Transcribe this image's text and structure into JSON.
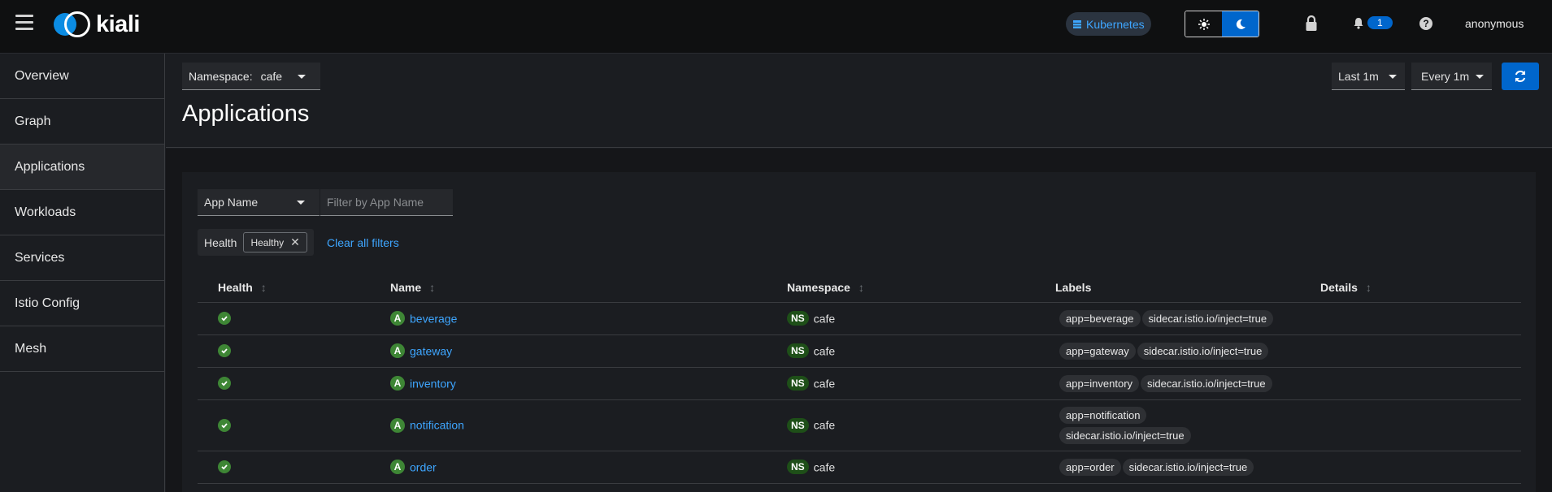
{
  "masthead": {
    "logo_text": "kiali",
    "cluster": "Kubernetes",
    "notifications_count": "1",
    "help_symbol": "?",
    "user": "anonymous",
    "accent": "#0066cc"
  },
  "sidebar": {
    "items": [
      {
        "label": "Overview"
      },
      {
        "label": "Graph"
      },
      {
        "label": "Applications"
      },
      {
        "label": "Workloads"
      },
      {
        "label": "Services"
      },
      {
        "label": "Istio Config"
      },
      {
        "label": "Mesh"
      }
    ],
    "active": "Applications"
  },
  "toolbar": {
    "namespace_label": "Namespace:",
    "namespace_value": "cafe",
    "time_range": "Last 1m",
    "refresh_interval": "Every 1m"
  },
  "page": {
    "title": "Applications"
  },
  "filters": {
    "type": "App Name",
    "placeholder": "Filter by App Name",
    "group_label": "Health",
    "chip": "Healthy",
    "chip_remove": "✕",
    "clear_all": "Clear all filters"
  },
  "table": {
    "headers": {
      "health": "Health",
      "name": "Name",
      "namespace": "Namespace",
      "labels": "Labels",
      "details": "Details"
    },
    "sort_glyph": "↕",
    "app_badge": "A",
    "ns_badge": "NS",
    "rows": [
      {
        "name": "beverage",
        "namespace": "cafe",
        "labels": [
          "app=beverage",
          "sidecar.istio.io/inject=true"
        ]
      },
      {
        "name": "gateway",
        "namespace": "cafe",
        "labels": [
          "app=gateway",
          "sidecar.istio.io/inject=true"
        ]
      },
      {
        "name": "inventory",
        "namespace": "cafe",
        "labels": [
          "app=inventory",
          "sidecar.istio.io/inject=true"
        ]
      },
      {
        "name": "notification",
        "namespace": "cafe",
        "labels": [
          "app=notification",
          "sidecar.istio.io/inject=true"
        ]
      },
      {
        "name": "order",
        "namespace": "cafe",
        "labels": [
          "app=order",
          "sidecar.istio.io/inject=true"
        ]
      }
    ],
    "health_status": "healthy",
    "healthy_color": "#3e8635"
  }
}
